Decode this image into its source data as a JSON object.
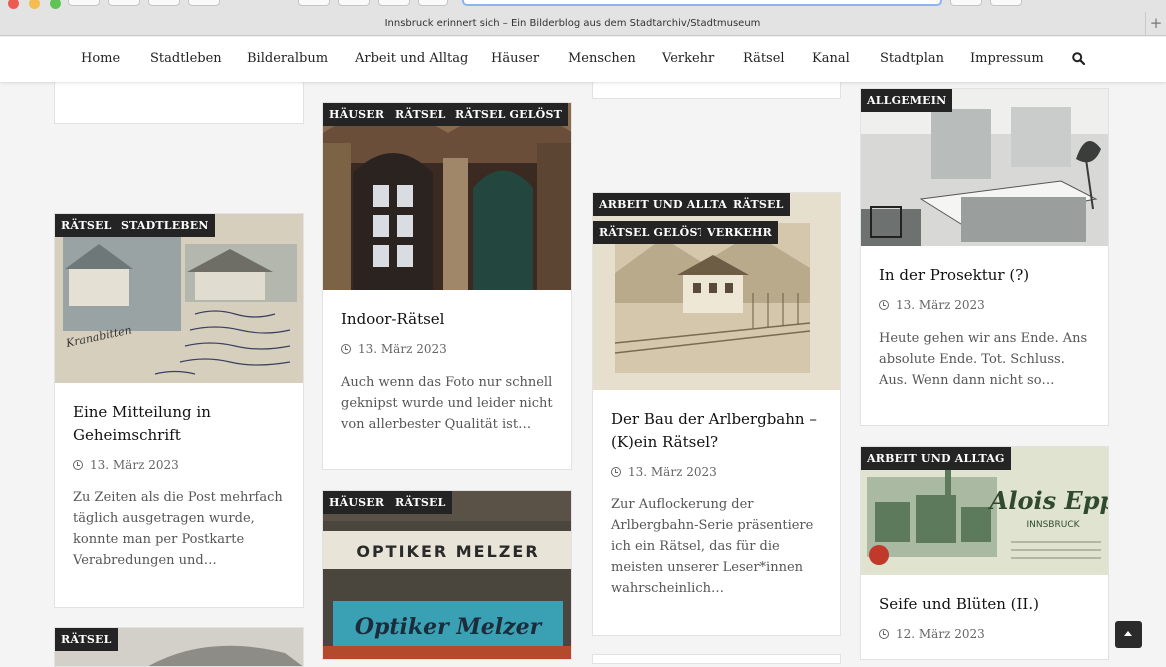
{
  "browser": {
    "tab_title": "Innsbruck erinnert sich – Ein Bilderblog aus dem Stadtarchiv/Stadtmuseum",
    "new_tab": "+"
  },
  "nav": {
    "items": [
      {
        "label": "Home"
      },
      {
        "label": "Stadtleben"
      },
      {
        "label": "Bilderalbum"
      },
      {
        "label": "Arbeit und Alltag"
      },
      {
        "label": "Häuser"
      },
      {
        "label": "Menschen"
      },
      {
        "label": "Verkehr"
      },
      {
        "label": "Rätsel"
      },
      {
        "label": "Kanal"
      },
      {
        "label": "Stadtplan"
      },
      {
        "label": "Impressum"
      }
    ],
    "search_icon": "search-icon"
  },
  "posts": [
    {
      "tags": [
        "RÄTSEL",
        "STADTLEBEN"
      ],
      "title": "Eine Mitteilung in Geheimschrift",
      "date": "13. März 2023",
      "excerpt": "Zu Zeiten als die Post mehrfach täglich ausgetragen wurde, konnte man per Postkarte Verabredungen und…"
    },
    {
      "tags": [
        "HÄUSER",
        "RÄTSEL",
        "RÄTSEL GELÖST"
      ],
      "title": "Indoor-Rätsel",
      "date": "13. März 2023",
      "excerpt": "Auch wenn das Foto nur schnell geknipst wurde und leider nicht von allerbester Qualität ist…"
    },
    {
      "tags": [
        "ARBEIT UND ALLTAG",
        "RÄTSEL",
        "RÄTSEL GELÖST",
        "VERKEHR"
      ],
      "title": "Der Bau der Arlbergbahn – (K)ein Rätsel?",
      "date": "13. März 2023",
      "excerpt": "Zur Auflockerung der Arlbergbahn-Serie präsentiere ich ein Rätsel, das für die meisten unserer Leser*innen wahrscheinlich…"
    },
    {
      "tags": [
        "ALLGEMEIN"
      ],
      "title": "In der Prosektur (?)",
      "date": "13. März 2023",
      "excerpt": "Heute gehen wir ans Ende. Ans absolute Ende. Tot. Schluss. Aus. Wenn dann nicht so…"
    },
    {
      "tags": [
        "HÄUSER",
        "RÄTSEL"
      ],
      "image_text": [
        "OPTIKER MELZER",
        "Optiker Melzer"
      ]
    },
    {
      "tags": [
        "ARBEIT UND ALLTAG"
      ],
      "title": "Seife und Blüten (II.)",
      "date": "12. März 2023",
      "image_text": [
        "Alois Epp",
        "INNSBRUCK"
      ]
    },
    {
      "tags": [
        "RÄTSEL"
      ]
    }
  ],
  "image_text": {
    "postcard_place": "Kranabitten"
  },
  "colors": {
    "tag_bg": "#242424",
    "accent_focus": "#8ab4f2"
  }
}
